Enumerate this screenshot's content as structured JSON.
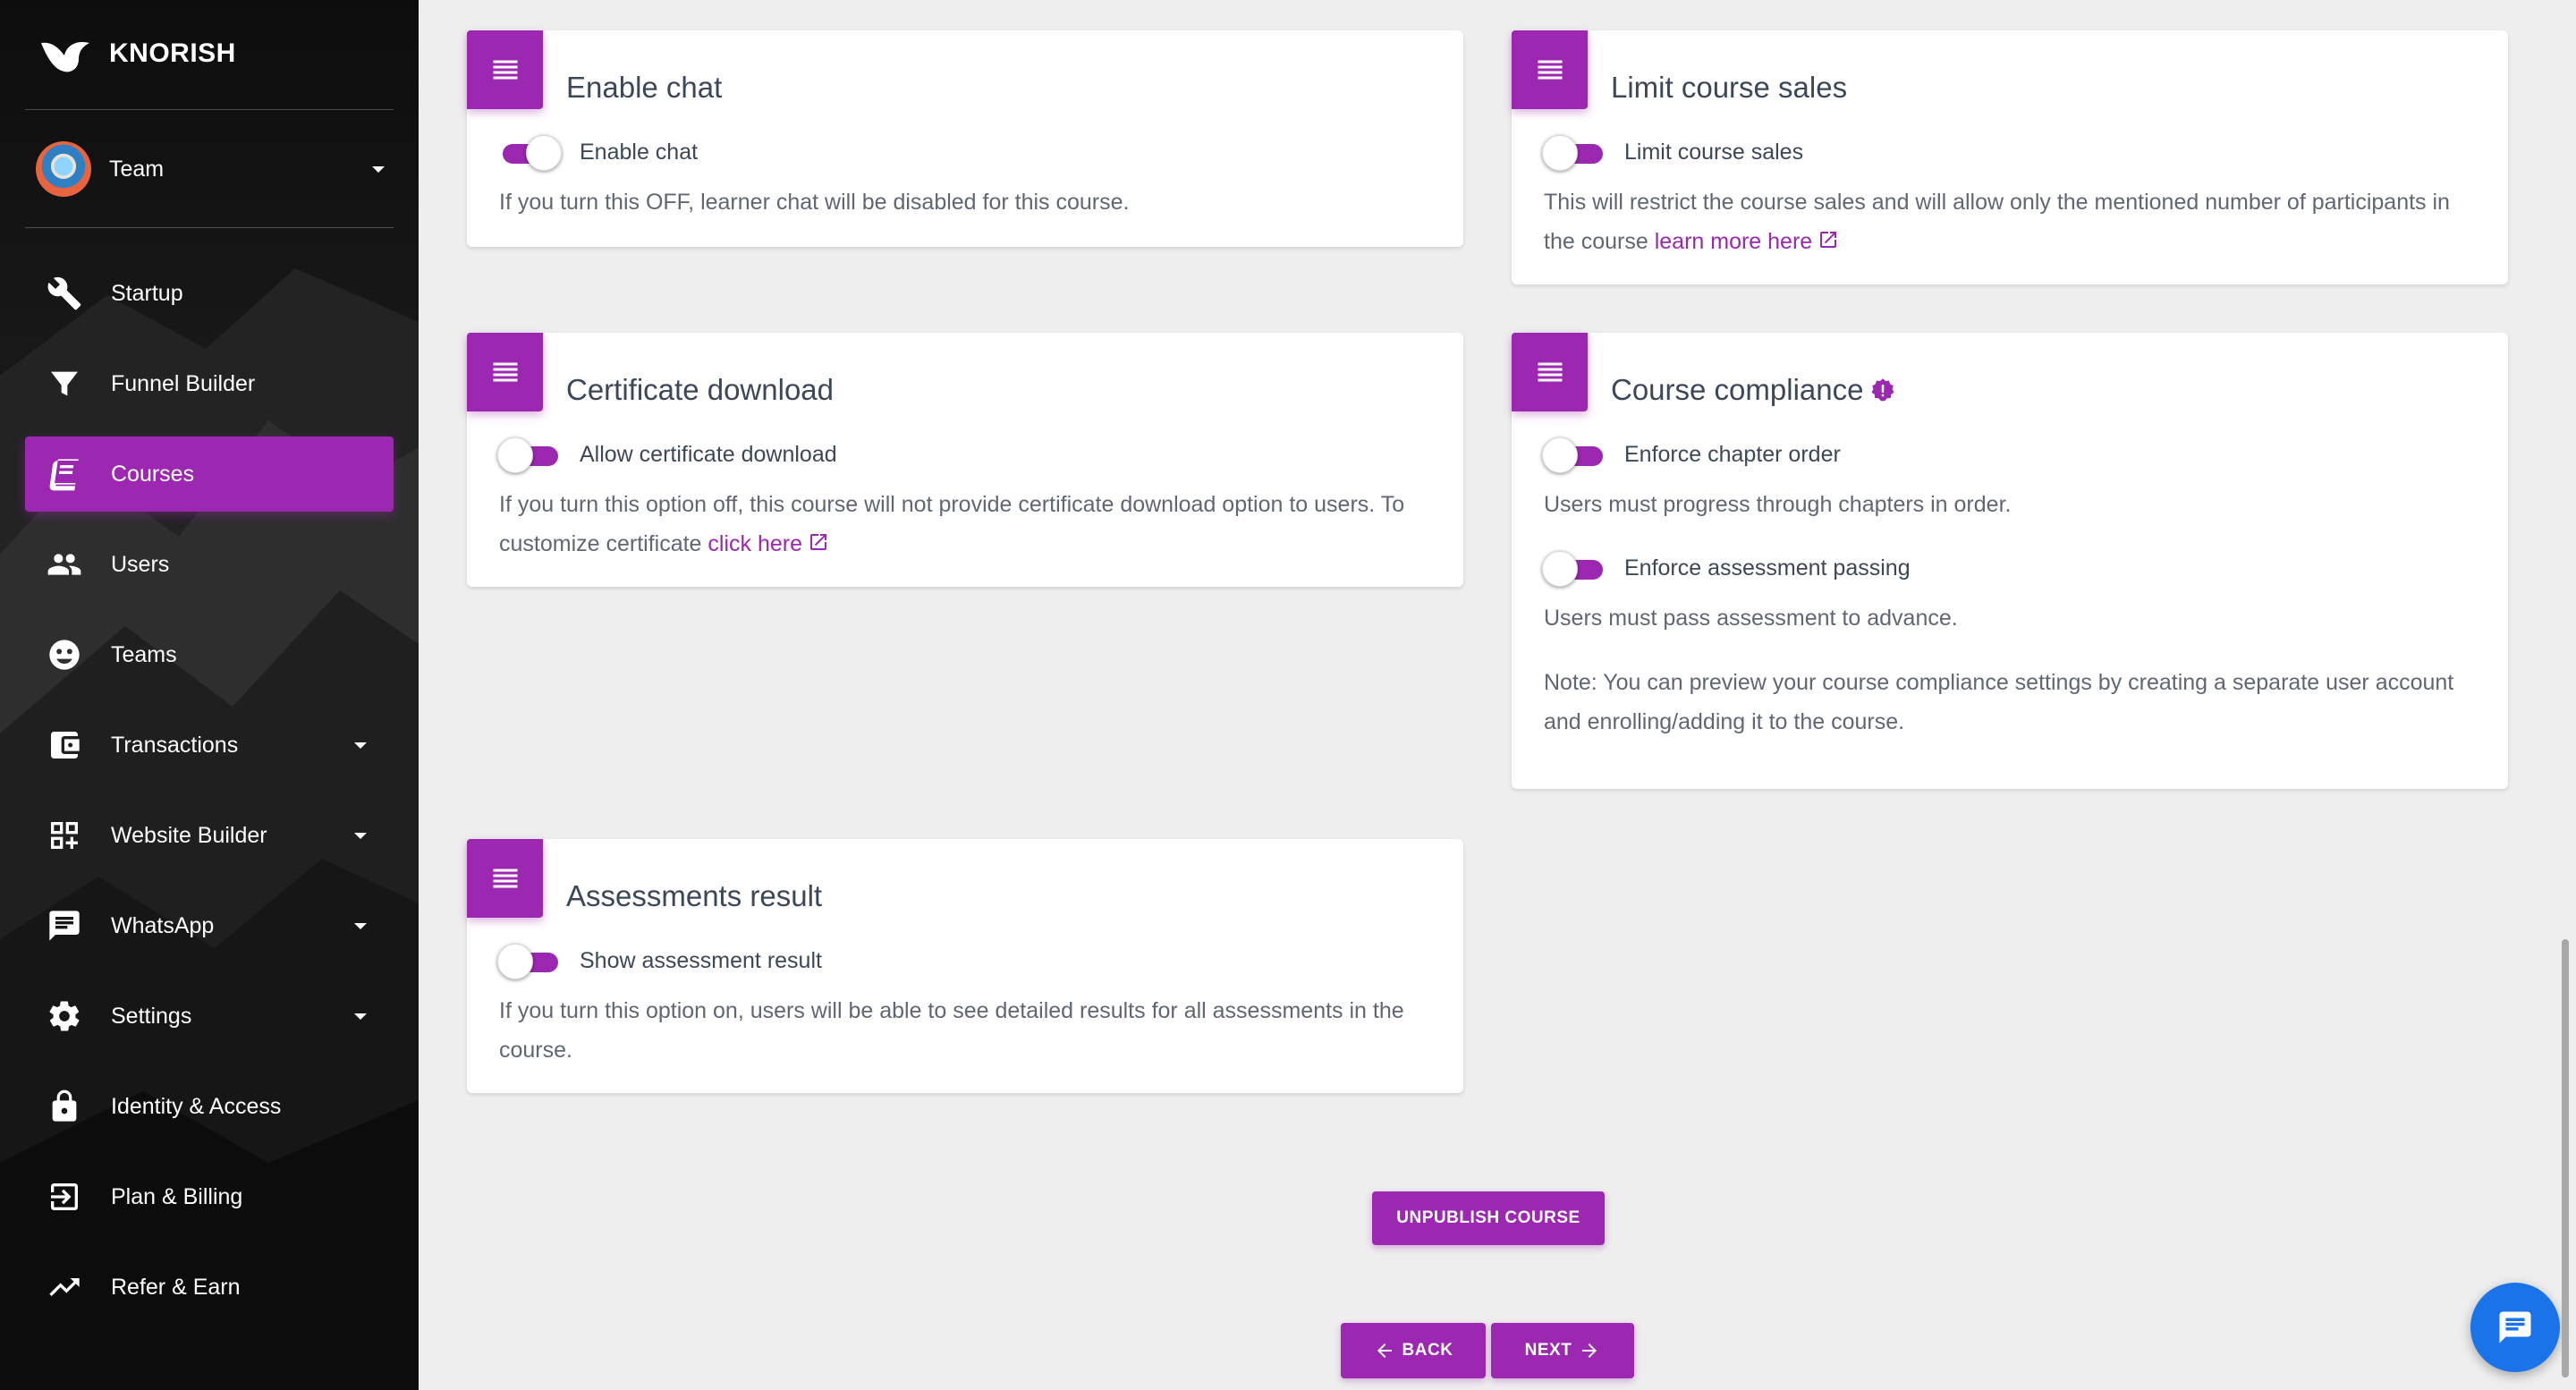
{
  "brand": {
    "name": "KNORISH"
  },
  "team": {
    "label": "Team"
  },
  "nav": [
    {
      "label": "Startup",
      "icon": "wrench-icon",
      "active": false,
      "has_caret": false
    },
    {
      "label": "Funnel Builder",
      "icon": "filter-icon",
      "active": false,
      "has_caret": false
    },
    {
      "label": "Courses",
      "icon": "book-icon",
      "active": true,
      "has_caret": false
    },
    {
      "label": "Users",
      "icon": "users-icon",
      "active": false,
      "has_caret": false
    },
    {
      "label": "Teams",
      "icon": "teams-icon",
      "active": false,
      "has_caret": false
    },
    {
      "label": "Transactions",
      "icon": "wallet-icon",
      "active": false,
      "has_caret": true
    },
    {
      "label": "Website Builder",
      "icon": "website-builder-icon",
      "active": false,
      "has_caret": true
    },
    {
      "label": "WhatsApp",
      "icon": "chat-icon",
      "active": false,
      "has_caret": true
    },
    {
      "label": "Settings",
      "icon": "gear-icon",
      "active": false,
      "has_caret": true
    },
    {
      "label": "Identity & Access",
      "icon": "lock-icon",
      "active": false,
      "has_caret": false
    },
    {
      "label": "Plan & Billing",
      "icon": "exit-icon",
      "active": false,
      "has_caret": false
    },
    {
      "label": "Refer & Earn",
      "icon": "trending-up-icon",
      "active": false,
      "has_caret": false
    }
  ],
  "cards": {
    "enable_chat": {
      "title": "Enable chat",
      "toggle_label": "Enable chat",
      "toggle_on": true,
      "description": "If you turn this OFF, learner chat will be disabled for this course."
    },
    "limit_sales": {
      "title": "Limit course sales",
      "toggle_label": "Limit course sales",
      "toggle_on": false,
      "description_line1": "This will restrict the course sales and will allow only the mentioned number of participants in",
      "description_line2": "the course",
      "link": "learn more here"
    },
    "certificate": {
      "title": "Certificate download",
      "toggle_label": "Allow certificate download",
      "toggle_on": false,
      "description_line1": "If you turn this option off, this course will not provide certificate download option to users. To",
      "description_line2": "customize certificate",
      "link": "click here"
    },
    "compliance": {
      "title": "Course compliance",
      "chapter_toggle_label": "Enforce chapter order",
      "chapter_toggle_on": false,
      "chapter_desc": "Users must progress through chapters in order.",
      "assessment_toggle_label": "Enforce assessment passing",
      "assessment_toggle_on": false,
      "assessment_desc": "Users must pass assessment to advance.",
      "note_line1": "Note: You can preview your course compliance settings by creating a separate user account",
      "note_line2": "and enrolling/adding it to the course."
    },
    "assessments": {
      "title": "Assessments result",
      "toggle_label": "Show assessment result",
      "toggle_on": false,
      "description_line1": "If you turn this option on, users will be able to see detailed results for all assessments in the",
      "description_line2": "course."
    }
  },
  "buttons": {
    "unpublish": "UNPUBLISH COURSE",
    "back": "BACK",
    "next": "NEXT"
  },
  "colors": {
    "accent": "#9c27b0",
    "chat_fab": "#1a73e8",
    "background": "#eeeeee"
  }
}
